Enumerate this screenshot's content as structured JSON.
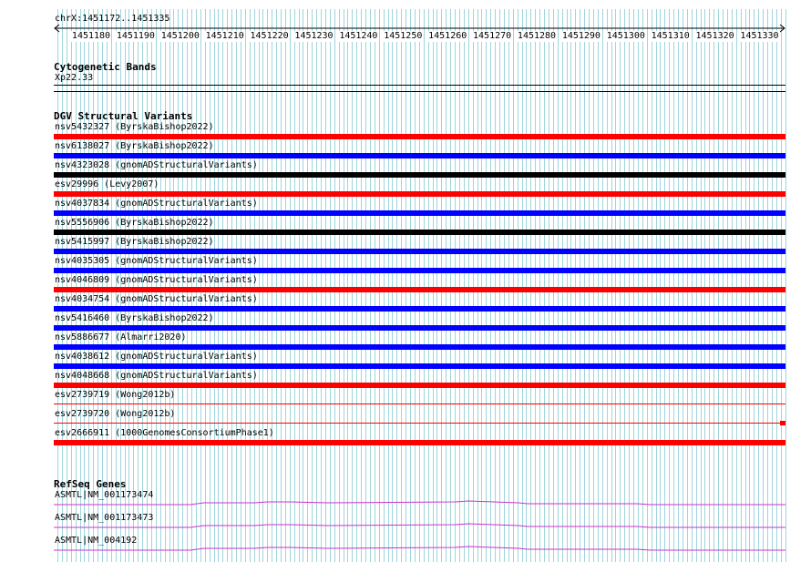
{
  "ruler": {
    "region_label": "chrX:1451172..1451335",
    "ticks": [
      "1451180",
      "1451190",
      "1451200",
      "1451210",
      "1451220",
      "1451230",
      "1451240",
      "1451250",
      "1451260",
      "1451270",
      "1451280",
      "1451290",
      "1451300",
      "1451310",
      "1451320",
      "1451330"
    ]
  },
  "cytoband": {
    "title": "Cytogenetic Bands",
    "band": "Xp22.33"
  },
  "dgv": {
    "title": "DGV Structural Variants",
    "variants": [
      {
        "label": "nsv5432327 (ByrskaBishop2022)",
        "color": "#ff0000",
        "style": "thick"
      },
      {
        "label": "nsv6138027 (ByrskaBishop2022)",
        "color": "#0000ff",
        "style": "thick"
      },
      {
        "label": "nsv4323028 (gnomADStructuralVariants)",
        "color": "#000000",
        "style": "thick"
      },
      {
        "label": "esv29996 (Levy2007)",
        "color": "#ff0000",
        "style": "thick"
      },
      {
        "label": "nsv4037834 (gnomADStructuralVariants)",
        "color": "#0000ff",
        "style": "thick"
      },
      {
        "label": "nsv5556906 (ByrskaBishop2022)",
        "color": "#000000",
        "style": "thick"
      },
      {
        "label": "nsv5415997 (ByrskaBishop2022)",
        "color": "#0000ff",
        "style": "thick"
      },
      {
        "label": "nsv4035305 (gnomADStructuralVariants)",
        "color": "#0000ff",
        "style": "thick"
      },
      {
        "label": "nsv4046809 (gnomADStructuralVariants)",
        "color": "#ff0000",
        "style": "thick"
      },
      {
        "label": "nsv4034754 (gnomADStructuralVariants)",
        "color": "#0000ff",
        "style": "thick"
      },
      {
        "label": "nsv5416460 (ByrskaBishop2022)",
        "color": "#0000ff",
        "style": "thick"
      },
      {
        "label": "nsv5886677 (Almarri2020)",
        "color": "#0000ff",
        "style": "thick"
      },
      {
        "label": "nsv4038612 (gnomADStructuralVariants)",
        "color": "#0000ff",
        "style": "thick"
      },
      {
        "label": "nsv4048668 (gnomADStructuralVariants)",
        "color": "#ff0000",
        "style": "thick"
      },
      {
        "label": "esv2739719 (Wong2012b)",
        "color": "#ff0000",
        "style": "thin"
      },
      {
        "label": "esv2739720 (Wong2012b)",
        "color": "#ff0000",
        "style": "thin-end"
      },
      {
        "label": "esv2666911 (1000GenomesConsortiumPhase1)",
        "color": "#ff0000",
        "style": "thick"
      }
    ]
  },
  "refseq": {
    "title": "RefSeq Genes",
    "line_color": "#cc33cc",
    "genes": [
      {
        "label": "ASMTL|NM_001173474"
      },
      {
        "label": "ASMTL|NM_001173473"
      },
      {
        "label": "ASMTL|NM_004192"
      }
    ]
  },
  "colors": {
    "grid_line": "#9fd5dc",
    "background": "#ffffff"
  }
}
